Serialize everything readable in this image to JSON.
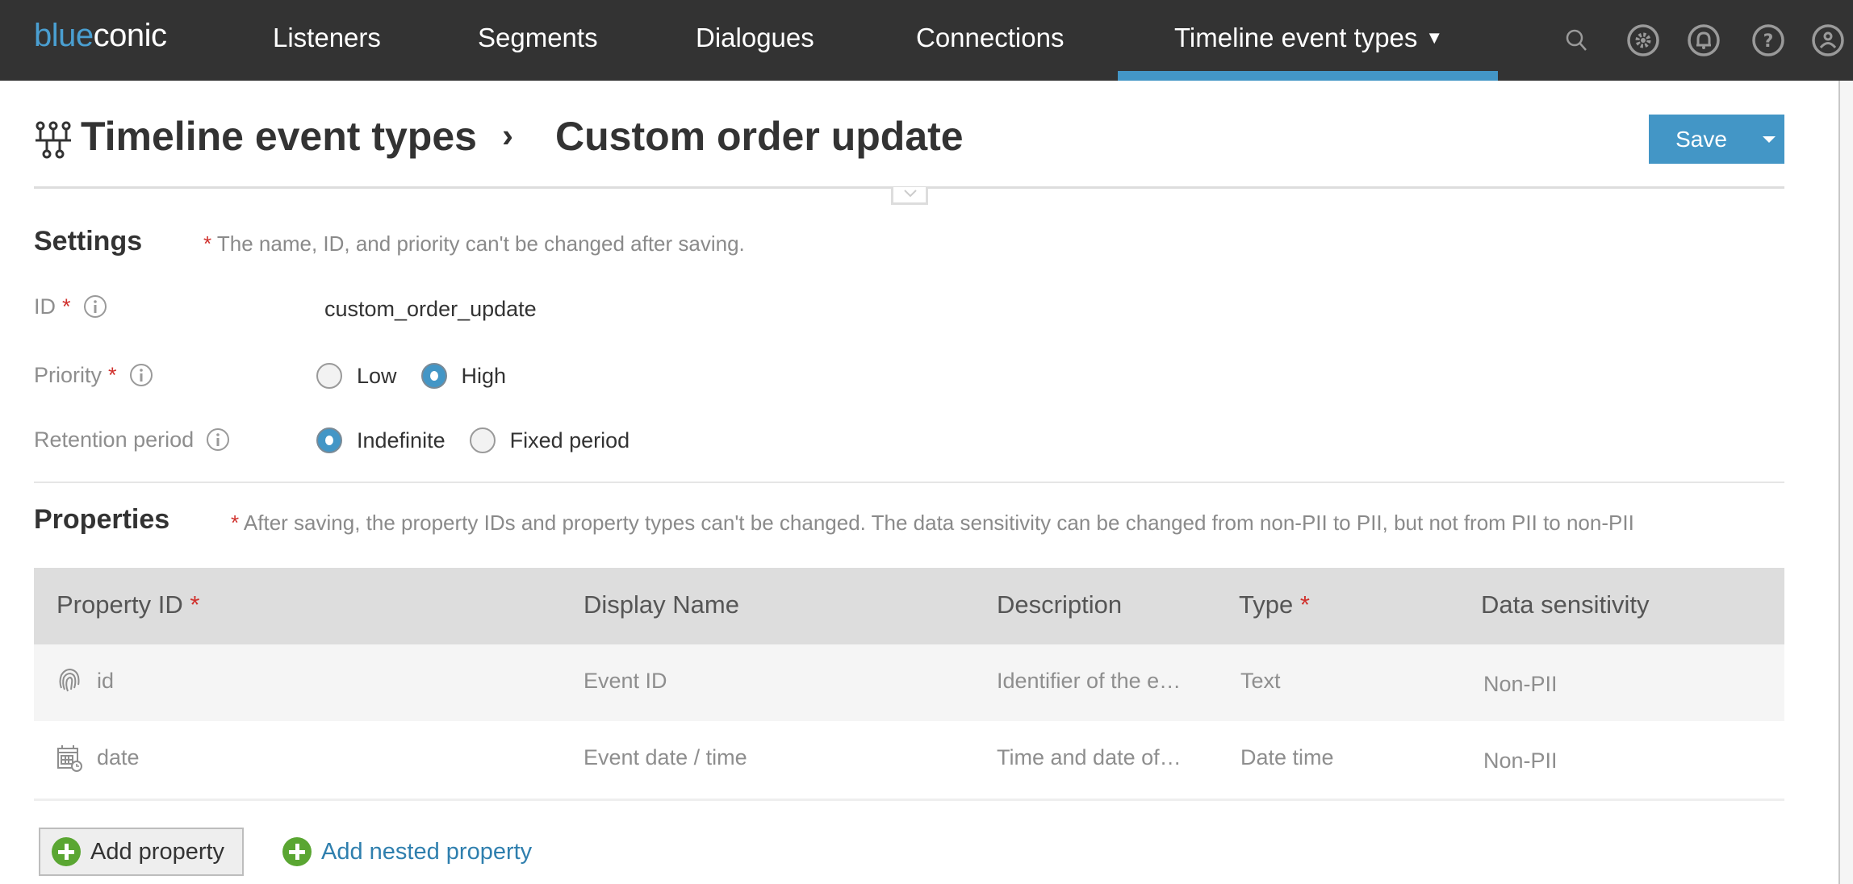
{
  "app": {
    "logo": {
      "part1": "blue",
      "part2": "conic"
    },
    "nav": [
      {
        "label": "Listeners"
      },
      {
        "label": "Segments"
      },
      {
        "label": "Dialogues"
      },
      {
        "label": "Connections"
      },
      {
        "label": "Timeline event types",
        "active": true,
        "has_dropdown": true
      }
    ],
    "nav_icons": [
      "search-icon",
      "gear-icon",
      "bell-icon",
      "help-icon",
      "user-icon"
    ],
    "accent_color": "#4396c6"
  },
  "header": {
    "icon": "timeline-event-types-icon",
    "breadcrumb_parent": "Timeline event types",
    "separator": "›",
    "title": "Custom order update",
    "save_label": "Save"
  },
  "settings": {
    "title": "Settings",
    "note_star": "*",
    "note": "The name, ID, and priority can't be changed after saving.",
    "fields": {
      "id": {
        "label": "ID",
        "required": "*",
        "value": "custom_order_update"
      },
      "priority": {
        "label": "Priority",
        "required": "*",
        "options": [
          "Low",
          "High"
        ],
        "selected": "High"
      },
      "retention": {
        "label": "Retention period",
        "options": [
          "Indefinite",
          "Fixed period"
        ],
        "selected": "Indefinite"
      }
    }
  },
  "properties": {
    "title": "Properties",
    "note_star": "*",
    "note": "After saving, the property IDs and property types can't be changed. The data sensitivity can be changed from non-PII to PII, but not from PII to non-PII",
    "columns": [
      {
        "label": "Property ID",
        "required": "*"
      },
      {
        "label": "Display Name"
      },
      {
        "label": "Description"
      },
      {
        "label": "Type",
        "required": "*"
      },
      {
        "label": "Data sensitivity"
      }
    ],
    "rows": [
      {
        "icon": "fingerprint-icon",
        "id": "id",
        "display_name": "Event ID",
        "description": "Identifier of the e…",
        "type": "Text",
        "sensitivity": "Non-PII"
      },
      {
        "icon": "calendar-clock-icon",
        "id": "date",
        "display_name": "Event date / time",
        "description": "Time and date of…",
        "type": "Date time",
        "sensitivity": "Non-PII"
      }
    ],
    "add_property_label": "Add property",
    "add_nested_label": "Add nested property"
  }
}
